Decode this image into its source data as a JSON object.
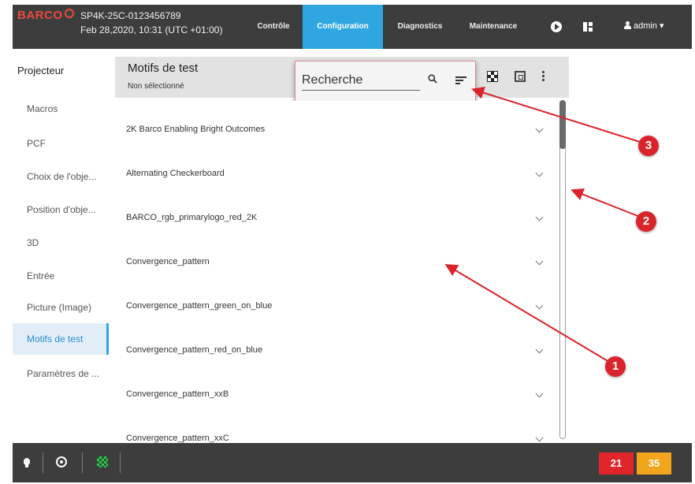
{
  "header": {
    "brand": "BARCO",
    "device_id": "SP4K-25C-0123456789",
    "datetime": "Feb 28,2020, 10:31 (UTC +01:00)",
    "tabs": [
      {
        "label": "Contrôle",
        "active": false
      },
      {
        "label": "Configuration",
        "active": true
      },
      {
        "label": "Diagnostics",
        "active": false
      },
      {
        "label": "Maintenance",
        "active": false
      }
    ],
    "user": "admin ▾",
    "icons": [
      "play-icon",
      "layout-icon",
      "user-icon"
    ]
  },
  "sidebar": {
    "title": "Projecteur",
    "items": [
      {
        "label": "Macros"
      },
      {
        "label": "PCF"
      },
      {
        "label": "Choix de l'obje..."
      },
      {
        "label": "Position d'obje..."
      },
      {
        "label": "3D"
      },
      {
        "label": "Entrée"
      },
      {
        "label": "Picture (Image)"
      },
      {
        "label": "Motifs de test",
        "active": true
      },
      {
        "label": "Paramètres de ..."
      }
    ]
  },
  "panel": {
    "title": "Motifs de test",
    "subtitle": "Non sélectionné",
    "search_placeholder": "Recherche",
    "rows": [
      "2K Barco Enabling Bright Outcomes",
      "Alternating Checkerboard",
      "BARCO_rgb_primarylogo_red_2K",
      "Convergence_pattern",
      "Convergence_pattern_green_on_blue",
      "Convergence_pattern_red_on_blue",
      "Convergence_pattern_xxB",
      "Convergence_pattern_xxC"
    ]
  },
  "footer": {
    "badge_red": "21",
    "badge_orange": "35",
    "colors": {
      "red": "#e0262b",
      "orange": "#f2a51c"
    }
  },
  "callouts": [
    "1",
    "2",
    "3"
  ],
  "colors": {
    "accent": "#2fa6e0",
    "bar": "#3d3d3d",
    "annotation": "#d9242b"
  }
}
